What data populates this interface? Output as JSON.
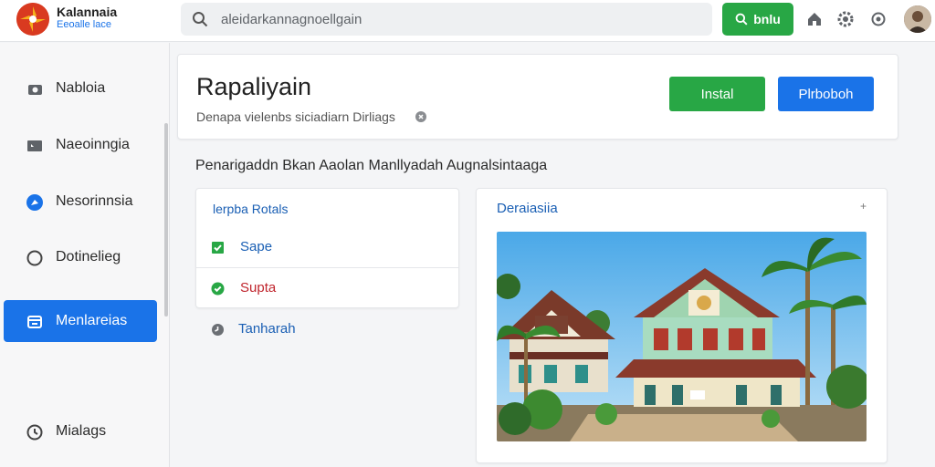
{
  "header": {
    "brand_name": "Kalannaia",
    "brand_sub": "Eeoalle lace",
    "search_placeholder": "aleidarkannagnoellgain",
    "search_button_label": "bnlu",
    "icons": [
      "logo-icon",
      "search-icon",
      "home-icon",
      "settings-icon",
      "refresh-icon",
      "avatar"
    ]
  },
  "sidebar": {
    "items": [
      {
        "label": "Nabloia",
        "icon": "camera-icon"
      },
      {
        "label": "Naeoinngia",
        "icon": "monitor-icon"
      },
      {
        "label": "Nesorinnsia",
        "icon": "compass-icon"
      },
      {
        "label": "Dotinelieg",
        "icon": "circle-icon"
      },
      {
        "label": "Menlareias",
        "icon": "card-icon",
        "active": true
      }
    ],
    "bottom_item": {
      "label": "Mialags",
      "icon": "history-icon"
    }
  },
  "main": {
    "title": "Rapaliyain",
    "subtitle": "Denapa vielenbs siciadiarn Dirliags",
    "install_label": "Instal",
    "secondary_label": "Plrboboh",
    "section_title": "Penarigaddn Bkan Aaolan Manllyadah Augnalsintaaga",
    "list": {
      "heading": "lerpba Rotals",
      "rows": [
        {
          "label": "Sape",
          "icon": "checkbox-icon",
          "color": "#1a5fb4"
        },
        {
          "label": "Supta",
          "icon": "check-circle-icon",
          "color": "#c0262e"
        }
      ],
      "extra_row": {
        "label": "Tanharah",
        "icon": "clock-icon"
      }
    },
    "image_card": {
      "title": "Deraiasiia",
      "more": "+"
    }
  },
  "colors": {
    "accent_green": "#28a745",
    "accent_blue": "#1a73e8",
    "logo_red": "#d93a20"
  }
}
